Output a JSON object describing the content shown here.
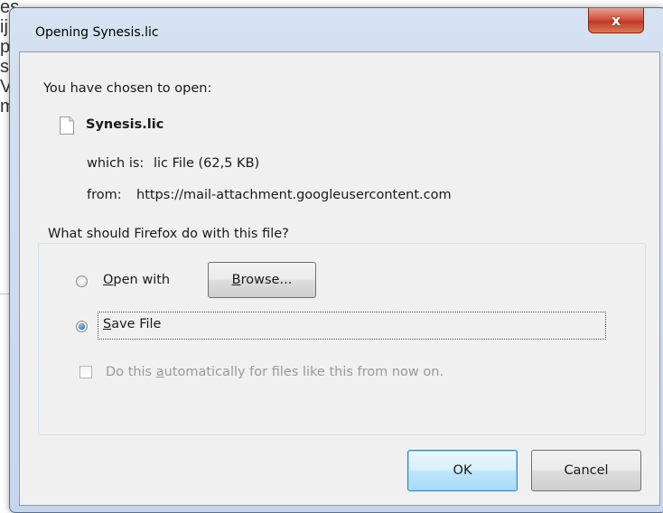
{
  "background": {
    "lines": [
      "es",
      "ij",
      "p",
      "s",
      "V",
      "m"
    ]
  },
  "dialog": {
    "title": "Opening Synesis.lic",
    "close_label": "x",
    "intro": "You have chosen to open:",
    "file_name": "Synesis.lic",
    "which_is_label": "which is:",
    "which_is_value": "lic File (62,5 KB)",
    "from_label": "from:",
    "from_value": "https://mail-attachment.googleusercontent.com",
    "question": "What should Firefox do with this file?",
    "open_with": {
      "label_rest": "pen with",
      "accesskey": "O",
      "selected": false
    },
    "browse_button": {
      "accesskey": "B",
      "label_rest": "rowse..."
    },
    "save_file": {
      "accesskey": "S",
      "label_rest": "ave File",
      "selected": true
    },
    "auto_checkbox": {
      "label_prefix": "Do this ",
      "accesskey": "a",
      "label_rest": "utomatically for files like this from now on.",
      "checked": false,
      "enabled": false
    },
    "ok_label": "OK",
    "cancel_label": "Cancel"
  }
}
